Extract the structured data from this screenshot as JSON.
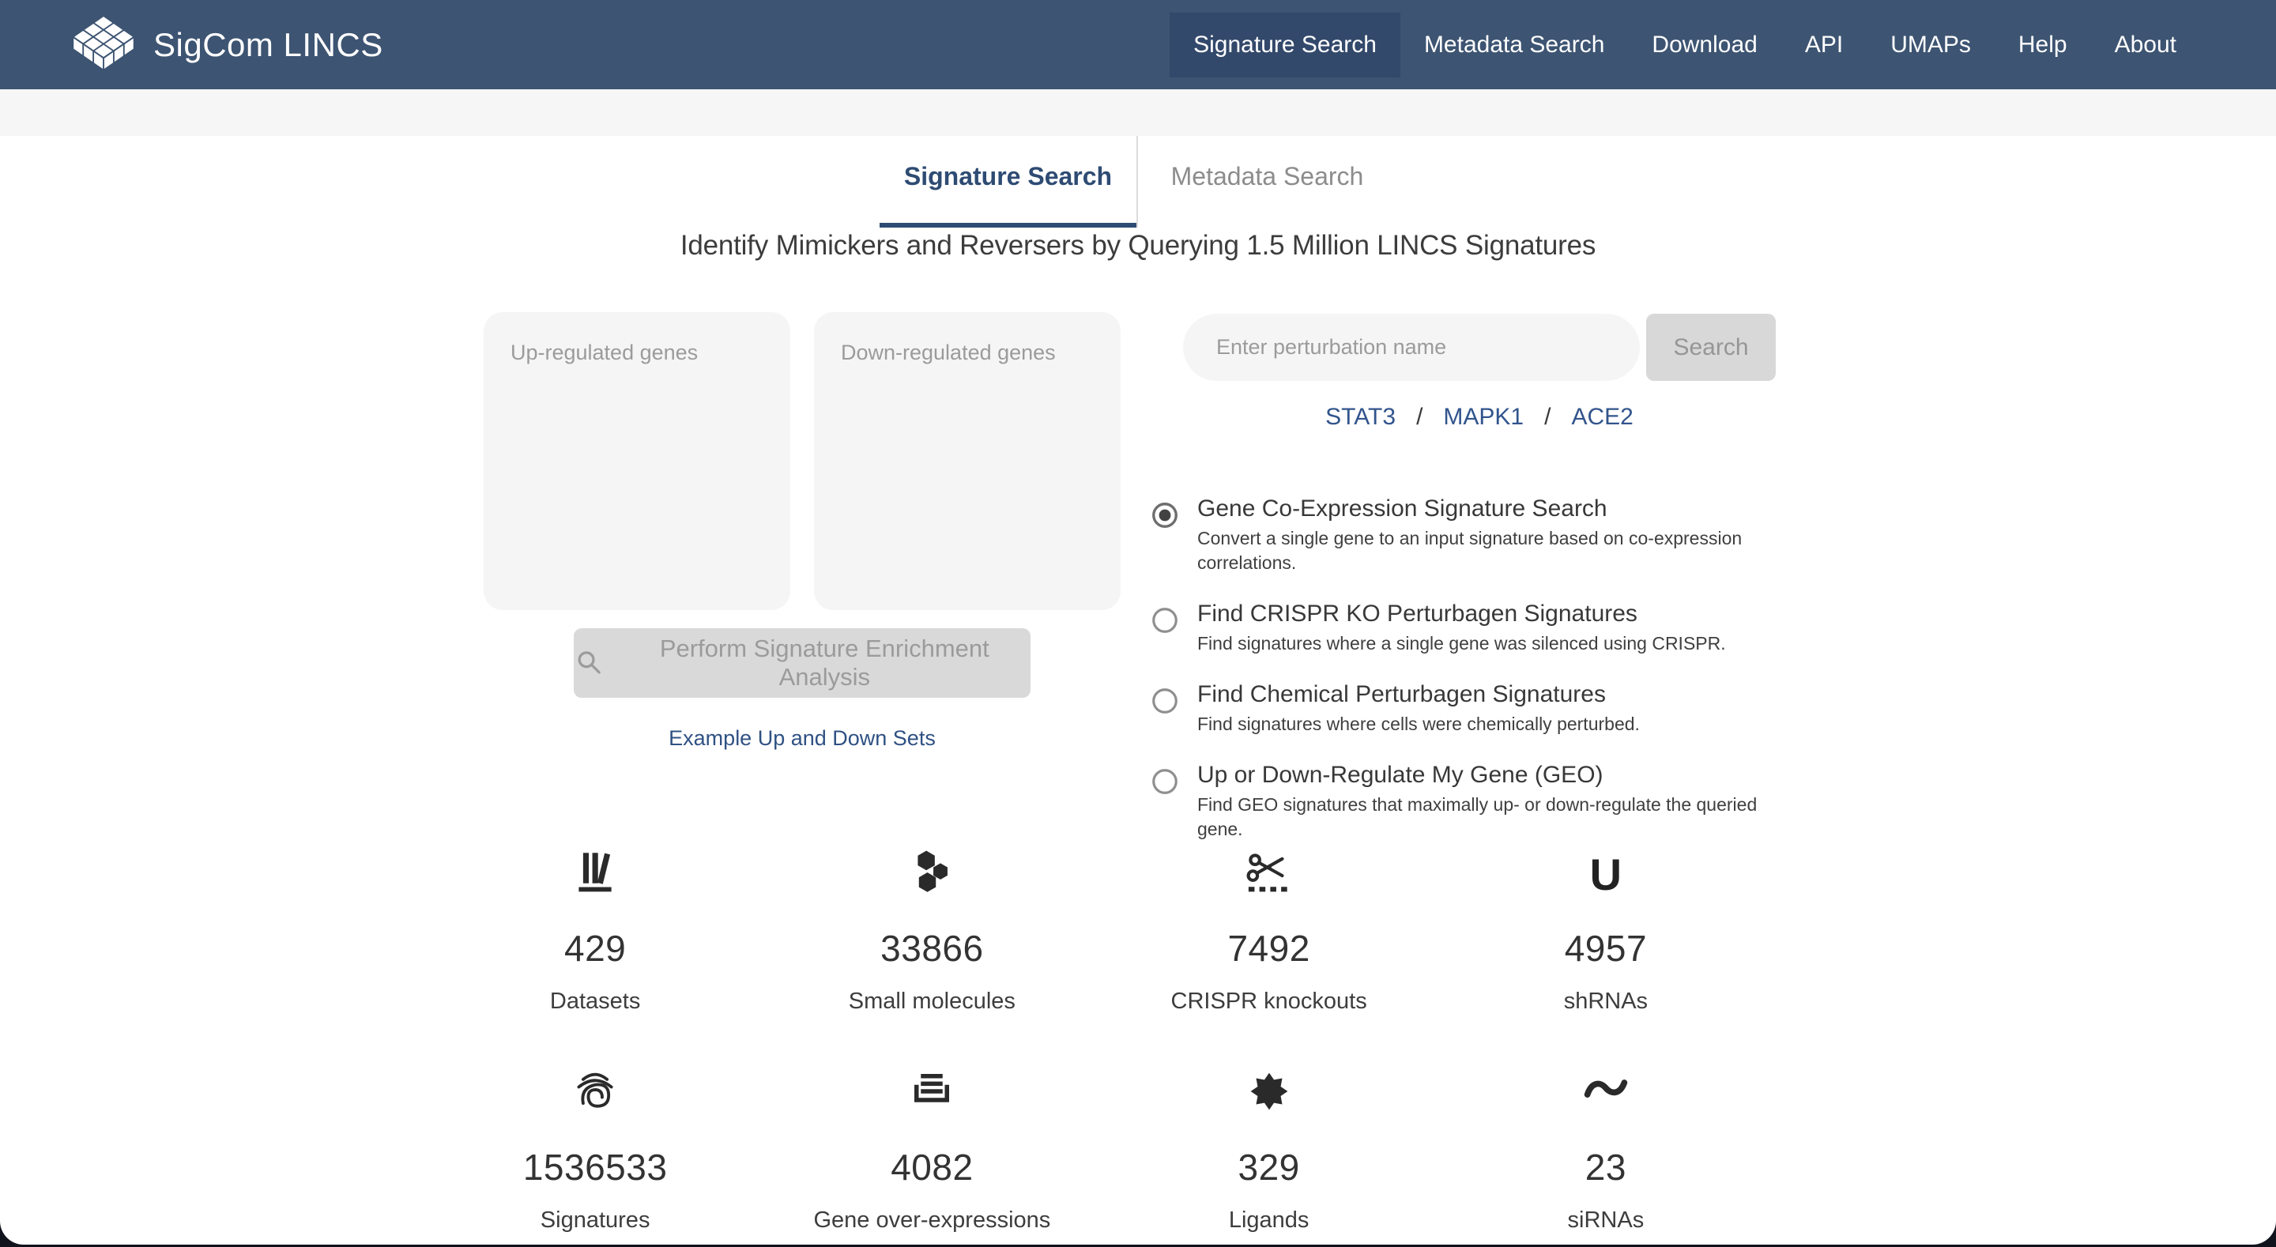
{
  "navbar": {
    "brand": "SigCom LINCS",
    "items": [
      {
        "label": "Signature Search",
        "active": true
      },
      {
        "label": "Metadata Search",
        "active": false
      },
      {
        "label": "Download",
        "active": false
      },
      {
        "label": "API",
        "active": false
      },
      {
        "label": "UMAPs",
        "active": false
      },
      {
        "label": "Help",
        "active": false
      },
      {
        "label": "About",
        "active": false
      }
    ]
  },
  "tabs": [
    {
      "label": "Signature Search",
      "active": true
    },
    {
      "label": "Metadata Search",
      "active": false
    }
  ],
  "heading": "Identify Mimickers and Reversers by Querying 1.5 Million LINCS Signatures",
  "signature_form": {
    "up_placeholder": "Up-regulated genes",
    "down_placeholder": "Down-regulated genes",
    "up_value": "",
    "down_value": "",
    "submit_label": "Perform Signature Enrichment Analysis",
    "example_link": "Example Up and Down Sets"
  },
  "gene_form": {
    "placeholder": "Enter perturbation name",
    "value": "",
    "search_label": "Search",
    "separator": "/",
    "examples": [
      "STAT3",
      "MAPK1",
      "ACE2"
    ]
  },
  "options": [
    {
      "title": "Gene Co-Expression Signature Search",
      "description": "Convert a single gene to an input signature based on co-expression correlations.",
      "selected": true
    },
    {
      "title": "Find CRISPR KO Perturbagen Signatures",
      "description": "Find signatures where a single gene was silenced using CRISPR.",
      "selected": false
    },
    {
      "title": "Find Chemical Perturbagen Signatures",
      "description": "Find signatures where cells were chemically perturbed.",
      "selected": false
    },
    {
      "title": "Up or Down-Regulate My Gene (GEO)",
      "description": "Find GEO signatures that maximally up- or down-regulate the queried gene.",
      "selected": false
    }
  ],
  "stats": [
    {
      "value": "429",
      "label": "Datasets",
      "icon": "library-icon"
    },
    {
      "value": "33866",
      "label": "Small molecules",
      "icon": "molecules-icon"
    },
    {
      "value": "7492",
      "label": "CRISPR knockouts",
      "icon": "scissors-icon"
    },
    {
      "value": "4957",
      "label": "shRNAs",
      "icon": "u-glyph-icon",
      "glyph": "U"
    },
    {
      "value": "1536533",
      "label": "Signatures",
      "icon": "fingerprint-icon"
    },
    {
      "value": "4082",
      "label": "Gene over-expressions",
      "icon": "stack-icon"
    },
    {
      "value": "329",
      "label": "Ligands",
      "icon": "burst-icon"
    },
    {
      "value": "23",
      "label": "siRNAs",
      "icon": "tilde-icon"
    }
  ],
  "colors": {
    "navbar": "#3d5472",
    "navbar_active": "#33496b",
    "tab_accent": "#2e4b73",
    "link_blue": "#31548c",
    "panel_gray": "#f5f5f5",
    "button_gray": "#d9d9d9",
    "footer_dark": "#10131c"
  }
}
